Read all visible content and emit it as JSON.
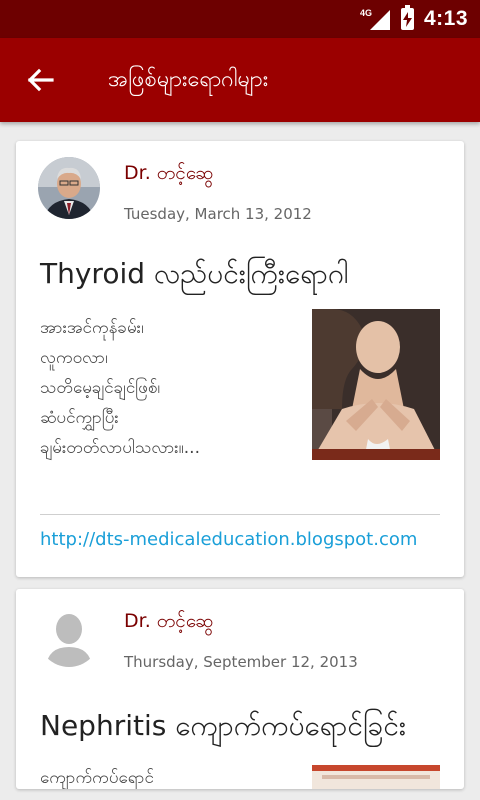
{
  "status_bar": {
    "network": "4G",
    "time": "4:13"
  },
  "app_bar": {
    "title": "အဖြစ်များရောဂါများ"
  },
  "posts": [
    {
      "author": "Dr. တင့်ဆွေ",
      "date": "Tuesday, March 13, 2012",
      "title": "Thyroid လည်ပင်းကြီးရောဂါ",
      "excerpt": [
        "အားအင်ကုန်ခမ်း၊",
        "လူကဝလာ၊",
        "သတိမေ့ချင်ချင်ဖြစ်၊",
        "ဆံပင်ကျွှာပြီး",
        "ချမ်းတတ်လာပါသလား။..."
      ],
      "link": "http://dts-medicaleducation.blogspot.com"
    },
    {
      "author": "Dr. တင့်ဆွေ",
      "date": "Thursday, September 12, 2013",
      "title": "Nephritis ကျောက်ကပ်ရောင်ခြင်း",
      "excerpt": [
        "ကျောက်ကပ်ရောင်"
      ]
    }
  ],
  "colors": {
    "status_bar": "#6d0000",
    "app_bar": "#9b0000",
    "author": "#7a0000",
    "link": "#1a9fd8"
  }
}
